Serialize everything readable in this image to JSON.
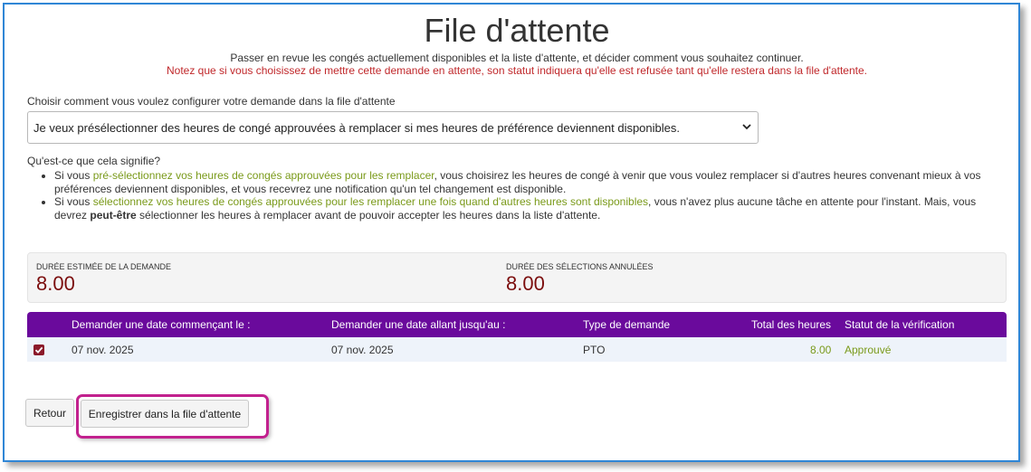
{
  "page": {
    "title": "File d'attente",
    "subtitle": "Passer en revue les congés actuellement disponibles et la liste d'attente, et décider comment vous souhaitez continuer.",
    "warning": "Notez que si vous choisissez de mettre cette demande en attente, son statut indiquera qu'elle est refusée tant qu'elle restera dans la file d'attente."
  },
  "config": {
    "label": "Choisir comment vous voulez configurer votre demande dans la file d'attente",
    "selected": "Je veux présélectionner des heures de congé approuvées à remplacer si mes heures de préférence deviennent disponibles."
  },
  "meaning": {
    "heading": "Qu'est-ce que cela signifie?",
    "items": [
      {
        "pre": "Si vous ",
        "highlight": "pré-sélectionnez vos heures de congés approuvées pour les remplacer",
        "post": ", vous choisirez les heures de congé à venir que vous voulez remplacer si d'autres heures convenant mieux à vos préférences deviennent disponibles, et vous recevrez une notification qu'un tel changement est disponible."
      },
      {
        "pre": "Si vous ",
        "highlight": "sélectionnez vos heures de congés approuvées pour les remplacer une fois quand d'autres heures sont disponibles",
        "post": ", vous n'avez plus aucune tâche en attente pour l'instant. Mais, vous devrez ",
        "bold": "peut-être",
        "post2": " sélectionner les heures à remplacer avant de pouvoir accepter les heures dans la liste d'attente."
      }
    ]
  },
  "summary": {
    "estimated_label": "Durée estimée de la demande",
    "estimated_value": "8.00",
    "cancelled_label": "Durée des sélections annulées",
    "cancelled_value": "8.00"
  },
  "table": {
    "headers": {
      "start": "Demander une date commençant le :",
      "end": "Demander une date allant jusqu'au :",
      "type": "Type de demande",
      "hours": "Total des heures",
      "status": "Statut de la vérification"
    },
    "rows": [
      {
        "start": "07 nov. 2025",
        "end": "07 nov. 2025",
        "type": "PTO",
        "hours": "8.00",
        "status": "Approuvé"
      }
    ]
  },
  "buttons": {
    "back": "Retour",
    "save": "Enregistrer dans la file d'attente"
  },
  "colors": {
    "header_purple": "#6a0a9c",
    "warning_red": "#c0282b",
    "value_maroon": "#7b0d0d",
    "green_text": "#7a9a1a",
    "highlight_magenta": "#c2218e"
  }
}
